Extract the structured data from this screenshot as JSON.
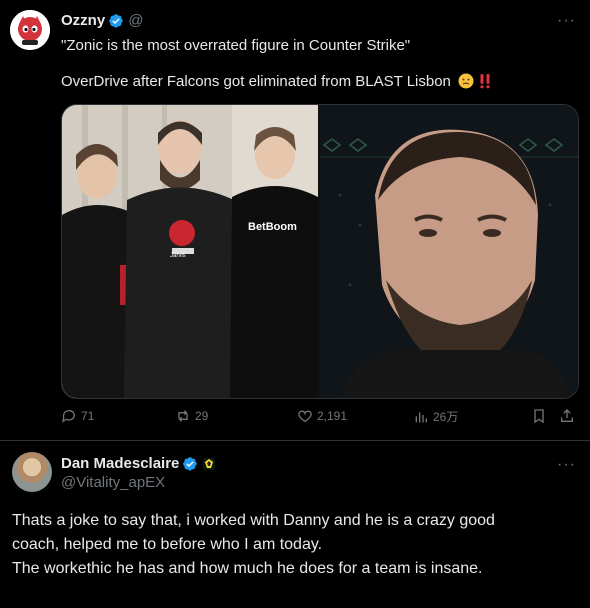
{
  "post": {
    "author_name": "Ozzny",
    "author_handle": "@",
    "more_label": "···",
    "text_line1": "\"Zonic is the most overrated figure in Counter Strike\"",
    "text_line2": "OverDrive after Falcons got eliminated from BLAST Lisbon",
    "emojis": [
      "face-emoji",
      "double-exclamation-emoji"
    ],
    "media": {
      "left_jersey_text": "BetBoom",
      "left_hoodie_text": "Jarvis"
    },
    "metrics": {
      "replies": "71",
      "reposts": "29",
      "likes": "2,191",
      "views": "26万"
    }
  },
  "reply": {
    "author_name": "Dan Madesclaire",
    "author_handle": "@Vitality_apEX",
    "more_label": "···",
    "line1": "Thats a joke to say that, i worked with Danny and he is a crazy good",
    "line2": "coach, helped me to before who I am today.",
    "line3": "The workethic he has and how much he does for a team is insane."
  },
  "colors": {
    "background": "#000000",
    "text": "#e7e9ea",
    "muted": "#71767b",
    "verified": "#1d9bf0",
    "divider": "#2f3336"
  }
}
